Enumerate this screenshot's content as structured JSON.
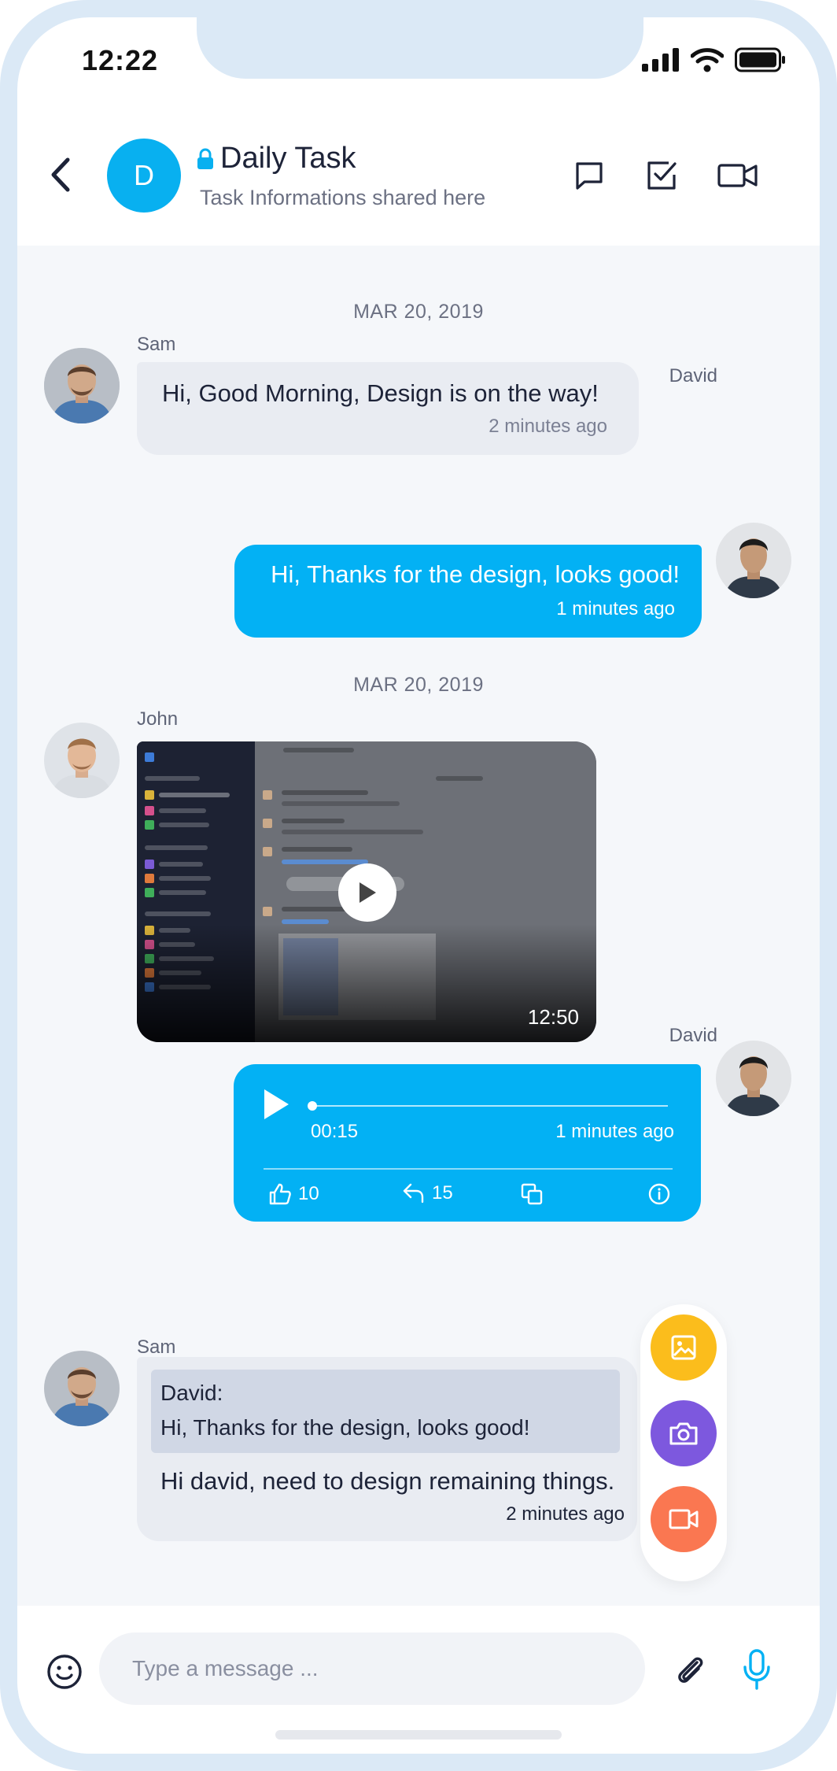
{
  "status_bar": {
    "time": "12:22"
  },
  "header": {
    "avatar_letter": "D",
    "title": "Daily Task",
    "subtitle": "Task Informations shared here"
  },
  "messages": [
    {
      "type": "date",
      "label": "MAR 20, 2019"
    },
    {
      "type": "text_in",
      "sender": "Sam",
      "text": "Hi, Good Morning, Design is on the way!",
      "time": "2 minutes ago"
    },
    {
      "type": "text_out",
      "sender": "David",
      "text": "Hi, Thanks for the design, looks good!",
      "time": "1 minutes ago"
    },
    {
      "type": "date",
      "label": "MAR 20, 2019"
    },
    {
      "type": "video_in",
      "sender": "John",
      "duration": "12:50"
    },
    {
      "type": "audio_out",
      "sender": "David",
      "elapsed": "00:15",
      "time": "1 minutes ago",
      "likes": "10",
      "replies": "15",
      "progress": 0
    },
    {
      "type": "reply_in",
      "sender": "Sam",
      "quote_author": "David:",
      "quote_text": "Hi, Thanks for the design, looks good!",
      "text": "Hi david, need to design remaining things.",
      "time": "2 minutes ago"
    }
  ],
  "composer": {
    "placeholder": "Type a message ..."
  },
  "colors": {
    "accent": "#03b1f4",
    "incoming_bubble": "#e9ecf2",
    "fab_image": "#fbbd1c",
    "fab_camera": "#7d58de",
    "fab_video": "#fa7751"
  },
  "icons": {
    "header": [
      "chevron-left-icon",
      "lock-icon",
      "chat-icon",
      "checkbox-icon",
      "video-camera-icon"
    ],
    "audio_actions": [
      "thumbs-up-icon",
      "reply-icon",
      "copy-icon",
      "info-icon"
    ],
    "fab": [
      "image-icon",
      "camera-icon",
      "video-icon"
    ],
    "composer": [
      "emoji-icon",
      "paperclip-icon",
      "microphone-icon"
    ]
  }
}
